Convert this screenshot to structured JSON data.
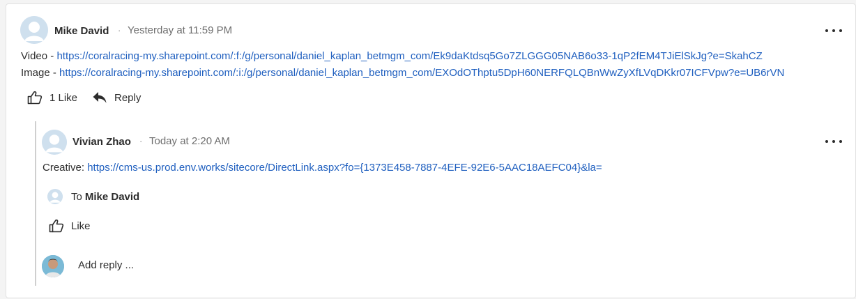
{
  "comment": {
    "author": "Mike David",
    "separator": "·",
    "timestamp": "Yesterday at 11:59 PM",
    "lines": [
      {
        "prefix": "Video - ",
        "link": "https://coralracing-my.sharepoint.com/:f:/g/personal/daniel_kaplan_betmgm_com/Ek9daKtdsq5Go7ZLGGG05NAB6o33-1qP2fEM4TJiElSkJg?e=SkahCZ"
      },
      {
        "prefix": "Image - ",
        "link": "https://coralracing-my.sharepoint.com/:i:/g/personal/daniel_kaplan_betmgm_com/EXOdOThptu5DpH60NERFQLQBnWwZyXfLVqDKkr07ICFVpw?e=UB6rVN"
      }
    ],
    "like_label": "1 Like",
    "reply_label": "Reply"
  },
  "reply": {
    "author": "Vivian Zhao",
    "separator": "·",
    "timestamp": "Today at 2:20 AM",
    "prefix": "Creative: ",
    "link": "https://cms-us.prod.env.works/sitecore/DirectLink.aspx?fo={1373E458-7887-4EFE-92E6-5AAC18AEFC04}&la=",
    "to_label": "To",
    "to_name": "Mike David",
    "like_label": "Like"
  },
  "composer": {
    "placeholder": "Add reply ..."
  },
  "colors": {
    "link": "#1f5fbf",
    "avatar_placeholder": "#cfe0ee"
  }
}
